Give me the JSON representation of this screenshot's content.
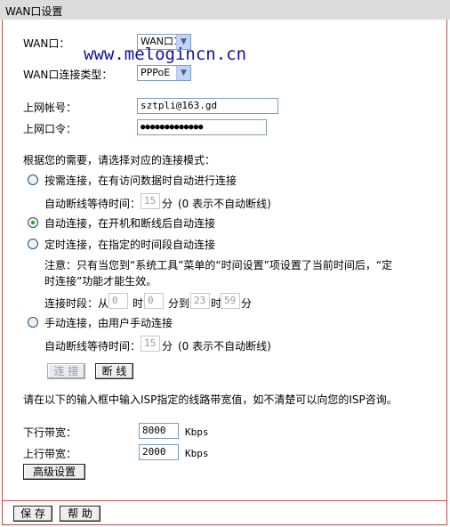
{
  "window": {
    "title": "WAN口设置"
  },
  "watermark": "www.melogincn.cn",
  "wan": {
    "label": "WAN口：",
    "value": "WAN口1"
  },
  "conn_type": {
    "label": "WAN口连接类型：",
    "value": "PPPoE"
  },
  "account": {
    "label": "上网帐号：",
    "value": "sztpli@163.gd"
  },
  "password": {
    "label": "上网口令：",
    "value": "●●●●●●●●●●●●●"
  },
  "mode_prompt": "根据您的需要，请选择对应的连接模式：",
  "modes": {
    "on_demand": {
      "label": "按需连接，在有访问数据时自动进行连接",
      "checked": false
    },
    "auto": {
      "label": "自动连接，在开机和断线后自动连接",
      "checked": true
    },
    "timed": {
      "label": "定时连接，在指定的时间段自动连接",
      "checked": false
    },
    "manual": {
      "label": "手动连接，由用户手动连接",
      "checked": false
    }
  },
  "idle1": {
    "label": "自动断线等待时间：",
    "value": "15",
    "unit": "分",
    "hint": "(0 表示不自动断线)"
  },
  "note_line1": "注意：只有当您到“系统工具”菜单的“时间设置”项设置了当前时间后，“定",
  "note_line2": "时连接”功能才能生效。",
  "period": {
    "label": "连接时段：从",
    "from_h": "0",
    "sep1": "时",
    "from_m": "0",
    "sep2": "分到",
    "to_h": "23",
    "sep3": "时",
    "to_m": "59",
    "sep4": "分"
  },
  "idle2": {
    "label": "自动断线等待时间：",
    "value": "15",
    "unit": "分",
    "hint": "(0 表示不自动断线)"
  },
  "buttons": {
    "connect": "连 接",
    "disconnect": "断 线",
    "advanced": "高级设置",
    "save": "保 存",
    "help": "帮 助"
  },
  "bandwidth_prompt": "请在以下的输入框中输入ISP指定的线路带宽值，如不清楚可以向您的ISP咨询。",
  "downlink": {
    "label": "下行带宽：",
    "value": "8000",
    "unit": "Kbps"
  },
  "uplink": {
    "label": "上行带宽：",
    "value": "2000",
    "unit": "Kbps"
  },
  "colors": {
    "border": "#c0504d",
    "titlebar": "#dcdcdc",
    "radio_checked": "#21a121"
  }
}
